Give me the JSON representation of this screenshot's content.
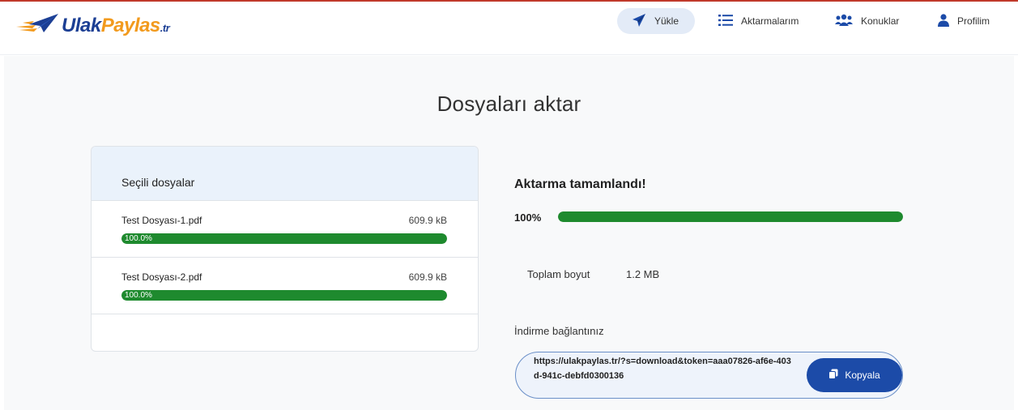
{
  "app": {
    "logo_main": "Ulak",
    "logo_accent": "Paylas",
    "logo_tld": ".tr"
  },
  "nav": {
    "upload": "Yükle",
    "transfers": "Aktarmalarım",
    "guests": "Konuklar",
    "profile": "Profilim"
  },
  "page": {
    "title": "Dosyaları aktar"
  },
  "files_card": {
    "header": "Seçili dosyalar",
    "files": [
      {
        "name": "Test Dosyası-1.pdf",
        "size": "609.9 kB",
        "progress_label": "100.0%",
        "progress": 1.0
      },
      {
        "name": "Test Dosyası-2.pdf",
        "size": "609.9 kB",
        "progress_label": "100.0%",
        "progress": 1.0
      }
    ]
  },
  "transfer": {
    "status_title": "Aktarma tamamlandı!",
    "percent_label": "100%",
    "progress": 1.0,
    "total_label": "Toplam boyut",
    "total_value": "1.2 MB",
    "download_label": "İndirme bağlantınız",
    "download_link": "https://ulakpaylas.tr/?s=download&token=aaa07826-af6e-403d-941c-debfd0300136",
    "copy_label": "Kopyala"
  },
  "colors": {
    "brand_blue": "#1c4ba8",
    "brand_orange": "#f29a1d",
    "progress_green": "#1e8a2e",
    "accent_red_line": "#c0392b"
  },
  "icons": {
    "logo": "paper-plane-logo",
    "upload": "paper-plane-icon",
    "transfers": "list-icon",
    "guests": "users-icon",
    "profile": "user-icon",
    "copy": "copy-icon"
  }
}
